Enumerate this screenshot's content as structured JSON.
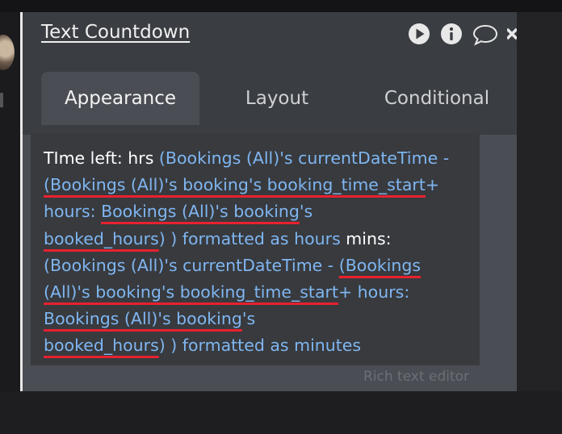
{
  "element": {
    "title": "Text Countdown"
  },
  "tabs": [
    {
      "label": "Appearance",
      "active": true
    },
    {
      "label": "Layout",
      "active": false
    },
    {
      "label": "Conditional",
      "active": false
    }
  ],
  "header_icons": [
    "play-icon",
    "info-icon",
    "comment-icon",
    "close-icon"
  ],
  "expression": {
    "lines": [
      [
        {
          "t": "TIme left: hrs  ",
          "type": "static"
        },
        {
          "t": "(Bookings (All)'s currentDateTime -",
          "type": "dynamic"
        }
      ],
      [
        {
          "t": " ",
          "type": "dynamic"
        },
        {
          "t": "(Bookings (All)'s booking's booking_time_start",
          "type": "dynamic",
          "u": true
        },
        {
          "t": "+",
          "type": "dynamic"
        }
      ],
      [
        {
          "t": "hours: ",
          "type": "dynamic"
        },
        {
          "t": "Bookings (All)'s booking",
          "type": "dynamic",
          "u": true
        },
        {
          "t": "'s",
          "type": "dynamic"
        }
      ],
      [
        {
          "t": "booked_hours",
          "type": "dynamic",
          "u": true
        },
        {
          "t": ") ) formatted as hours ",
          "type": "dynamic"
        },
        {
          "t": "mins:",
          "type": "static"
        }
      ],
      [
        {
          "t": " (Bookings (All)'s currentDateTime -  ",
          "type": "dynamic"
        },
        {
          "t": "(Bookings",
          "type": "dynamic",
          "u": true
        }
      ],
      [
        {
          "t": "(All)'s booking's booking_time_start",
          "type": "dynamic",
          "u": true
        },
        {
          "t": "+ hours:",
          "type": "dynamic"
        }
      ],
      [
        {
          "t": "Bookings (All)'s booking",
          "type": "dynamic",
          "u": true
        },
        {
          "t": "'s",
          "type": "dynamic"
        }
      ],
      [
        {
          "t": "booked_hours",
          "type": "dynamic",
          "u": true
        },
        {
          "t": ") ) formatted as minutes",
          "type": "dynamic"
        }
      ]
    ]
  },
  "footer": {
    "label": "Rich text editor"
  },
  "colors": {
    "dynamic_text": "#7fb6f1",
    "underline": "#e8212f",
    "panel": "#4a4d53",
    "header": "#3a3d42"
  }
}
